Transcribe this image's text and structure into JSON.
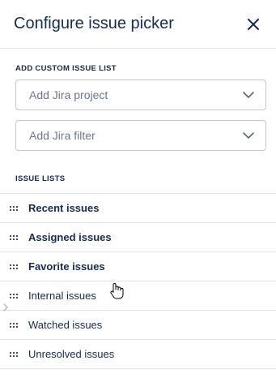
{
  "header": {
    "title": "Configure issue picker"
  },
  "custom_list": {
    "section_label": "ADD CUSTOM ISSUE LIST",
    "project_placeholder": "Add Jira project",
    "filter_placeholder": "Add Jira filter"
  },
  "issue_lists": {
    "section_label": "ISSUE LISTS",
    "items": [
      {
        "label": "Recent issues",
        "enabled": true
      },
      {
        "label": "Assigned issues",
        "enabled": true
      },
      {
        "label": "Favorite issues",
        "enabled": true
      },
      {
        "label": "Internal issues",
        "enabled": false
      },
      {
        "label": "Watched issues",
        "enabled": false
      },
      {
        "label": "Unresolved issues",
        "enabled": false
      }
    ]
  },
  "icons": {
    "close": "close-icon",
    "dropdown": "chevron-down-icon",
    "drag": "drag-handle-icon",
    "cursor": "hand-pointer-icon"
  },
  "colors": {
    "text": "#172b4d",
    "placeholder": "#6b778c",
    "border": "#c1c7d0",
    "divider": "#dfe1e6"
  }
}
